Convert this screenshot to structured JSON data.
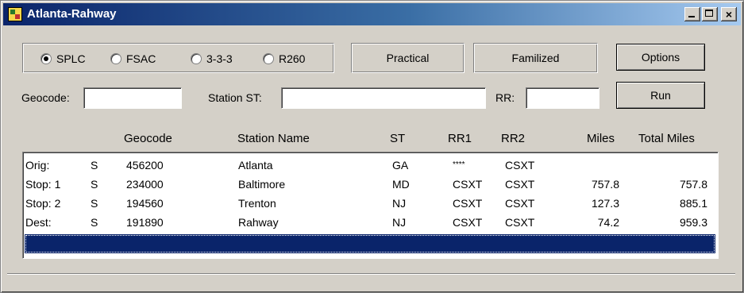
{
  "window": {
    "title": "Atlanta-Rahway"
  },
  "radio_options": [
    {
      "label": "SPLC",
      "selected": true
    },
    {
      "label": "FSAC",
      "selected": false
    },
    {
      "label": "3-3-3",
      "selected": false
    },
    {
      "label": "R260",
      "selected": false
    }
  ],
  "mode_boxes": {
    "practical": "Practical",
    "familized": "Familized"
  },
  "buttons": {
    "options": "Options",
    "run": "Run"
  },
  "fields": {
    "geocode_label": "Geocode:",
    "geocode_value": "",
    "station_label": "Station ST:",
    "station_value": "",
    "rr_label": "RR:",
    "rr_value": ""
  },
  "grid": {
    "headers": [
      "Geocode",
      "Station Name",
      "ST",
      "RR1",
      "RR2",
      "Miles",
      "Total Miles"
    ],
    "rows": [
      {
        "type": "Orig:",
        "flag": "S",
        "geocode": "456200",
        "station": "Atlanta",
        "st": "GA",
        "rr1": "****",
        "rr2": "CSXT",
        "miles": "",
        "total": ""
      },
      {
        "type": "Stop: 1",
        "flag": "S",
        "geocode": "234000",
        "station": "Baltimore",
        "st": "MD",
        "rr1": "CSXT",
        "rr2": "CSXT",
        "miles": "757.8",
        "total": "757.8"
      },
      {
        "type": "Stop: 2",
        "flag": "S",
        "geocode": "194560",
        "station": "Trenton",
        "st": "NJ",
        "rr1": "CSXT",
        "rr2": "CSXT",
        "miles": "127.3",
        "total": "885.1"
      },
      {
        "type": "Dest:",
        "flag": "S",
        "geocode": "191890",
        "station": "Rahway",
        "st": "NJ",
        "rr1": "CSXT",
        "rr2": "CSXT",
        "miles": "74.2",
        "total": "959.3"
      }
    ]
  }
}
